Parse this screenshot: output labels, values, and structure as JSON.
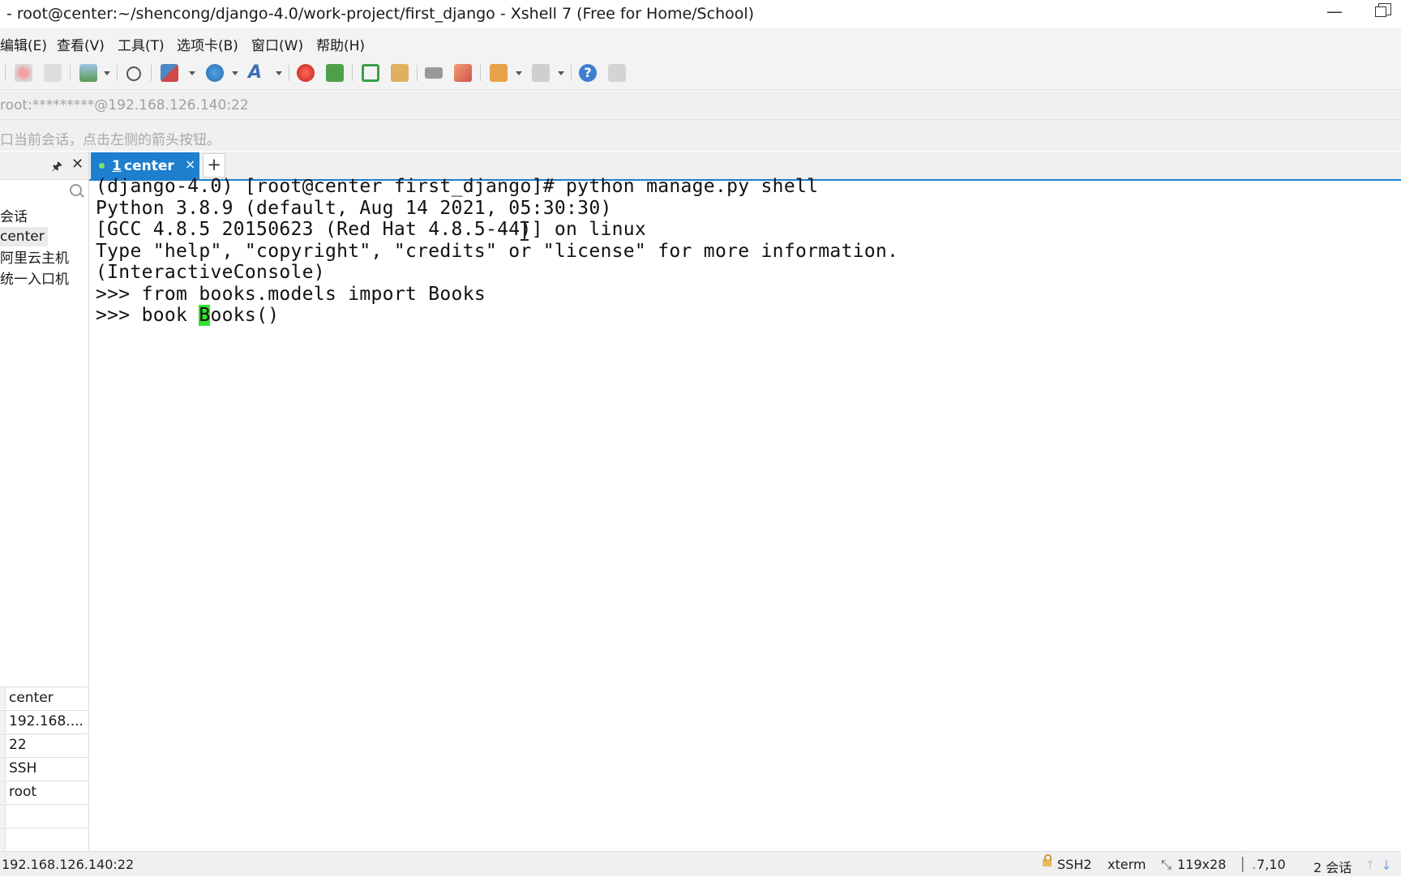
{
  "window": {
    "title": "- root@center:~/shencong/django-4.0/work-project/first_django - Xshell 7 (Free for Home/School)",
    "minimize": "—"
  },
  "menubar": {
    "items": [
      "编辑(E)",
      "查看(V)",
      "工具(T)",
      "选项卡(B)",
      "窗口(W)",
      "帮助(H)"
    ]
  },
  "toolbar": {
    "icons": [
      "new-session-icon",
      "connect-icon",
      "disconnect-icon",
      "properties-icon",
      "find-icon",
      "layout-icon",
      "globe-icon",
      "font-icon",
      "xmanager-icon",
      "xftp-icon",
      "fullscreen-icon",
      "lock-icon",
      "keyboard-icon",
      "highlight-icon",
      "session-manager-icon",
      "compose-icon",
      "help-icon",
      "chat-icon"
    ]
  },
  "address": {
    "text": "root:*********@192.168.126.140:22"
  },
  "hint": {
    "text": "口当前会话，点击左侧的箭头按钮。"
  },
  "sidebar": {
    "tree": [
      "会话",
      "center",
      "阿里云主机",
      "统一入口机"
    ],
    "properties": [
      "center",
      "192.168....",
      "22",
      "SSH",
      "root"
    ]
  },
  "tabs": [
    {
      "num": "1",
      "label": " center",
      "close": "×"
    }
  ],
  "tab_add": "+",
  "terminal": {
    "lines": [
      "(django-4.0) [root@center first_django]# python manage.py shell",
      "Python 3.8.9 (default, Aug 14 2021, 05:30:30)",
      "[GCC 4.8.5 20150623 (Red Hat 4.8.5-44)] on linux",
      "Type \"help\", \"copyright\", \"credits\" or \"license\" for more information.",
      "(InteractiveConsole)",
      ">>> from books.models import Books"
    ],
    "last_line_before_cursor": ">>> book ",
    "cursor_char": "B",
    "last_line_after_cursor": "ooks()"
  },
  "status": {
    "host": "192.168.126.140:22",
    "protocol": "SSH2",
    "term": "xterm",
    "size": "119x28",
    "position": "7,10",
    "sessions": "2 会话"
  }
}
